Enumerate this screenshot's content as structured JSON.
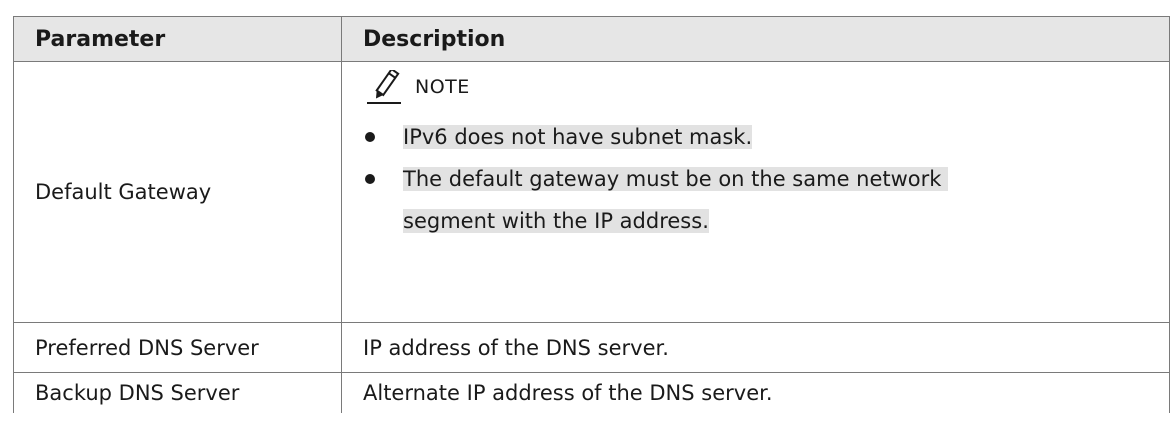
{
  "table": {
    "headers": {
      "parameter": "Parameter",
      "description": "Description"
    },
    "rows": [
      {
        "parameter": "Default Gateway",
        "note_label": "NOTE",
        "note_items": [
          "IPv6 does not have subnet mask.",
          "The default gateway must be on the same network ",
          "segment with the IP address."
        ]
      },
      {
        "parameter": "Preferred DNS Server",
        "description": "IP address of the DNS server."
      },
      {
        "parameter": "Backup DNS Server",
        "description": "Alternate IP address of the DNS server."
      }
    ]
  },
  "icons": {
    "note": "pencil-note-icon"
  },
  "colors": {
    "header_bg": "#e6e6e6",
    "highlight": "#e2e2e2",
    "border": "#7a7a7a"
  }
}
